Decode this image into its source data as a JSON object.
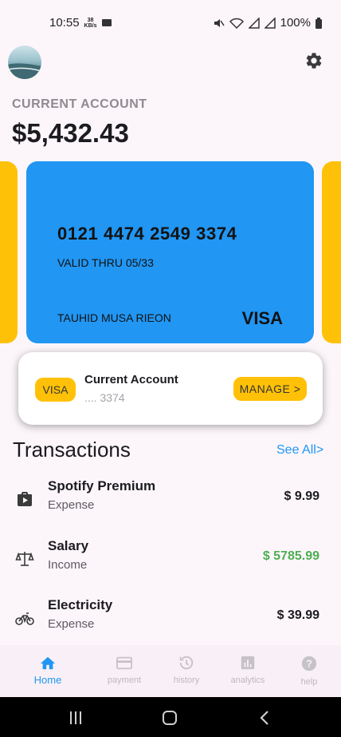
{
  "status_bar": {
    "time": "10:55",
    "net_speed": "38",
    "net_unit": "KB/s",
    "battery": "100%"
  },
  "header": {
    "avatar_icon": "avatar-photo",
    "settings_icon": "gear-icon"
  },
  "account": {
    "label": "CURRENT ACCOUNT",
    "balance": "$5,432.43"
  },
  "card": {
    "number": "0121 4474 2549 3374",
    "valid_thru": "VALID THRU 05/33",
    "holder": "TAUHID MUSA RIEON",
    "brand": "VISA",
    "color": "#2196F3",
    "side_color": "#FFC107"
  },
  "account_panel": {
    "chip_label": "VISA",
    "title": "Current Account",
    "masked_number": ".... 3374",
    "manage_label": "MANAGE  >"
  },
  "transactions": {
    "heading": "Transactions",
    "see_all": "See All>",
    "items": [
      {
        "title": "Spotify Premium",
        "type": "Expense",
        "amount": "$ 9.99",
        "icon": "play-bag-icon",
        "amount_color": "#1c1b1f"
      },
      {
        "title": "Salary",
        "type": "Income",
        "amount": "$ 5785.99",
        "icon": "scale-icon",
        "amount_color": "#4CAF50"
      },
      {
        "title": "Electricity",
        "type": "Expense",
        "amount": "$ 39.99",
        "icon": "bike-icon",
        "amount_color": "#1c1b1f"
      }
    ]
  },
  "bottom_nav": {
    "items": [
      {
        "label": "Home",
        "icon": "home-icon",
        "active": true
      },
      {
        "label": "payment",
        "icon": "card-icon",
        "active": false
      },
      {
        "label": "history",
        "icon": "history-icon",
        "active": false
      },
      {
        "label": "analytics",
        "icon": "analytics-icon",
        "active": false
      },
      {
        "label": "help",
        "icon": "help-icon",
        "active": false
      }
    ],
    "active_color": "#2196F3"
  }
}
